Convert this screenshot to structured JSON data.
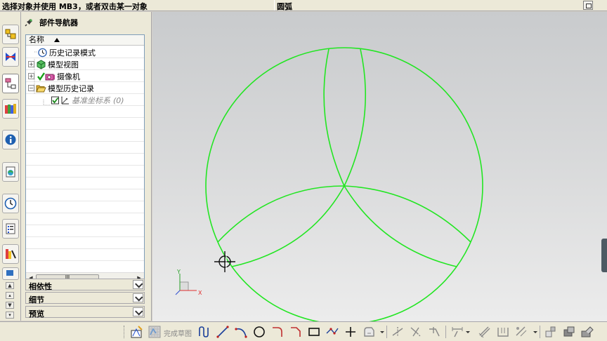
{
  "statusbar": {
    "prompt": "选择对象并使用 MB3，或者双击某一对象",
    "mode": "圆弧"
  },
  "navigator": {
    "title": "部件导航器",
    "column_name": "名称",
    "nodes": [
      {
        "label": "历史记录模式",
        "icon": "clock-icon",
        "expander": ""
      },
      {
        "label": "模型视图",
        "icon": "model-views-icon",
        "expander": "+"
      },
      {
        "label": "摄像机",
        "icon": "camera-icon",
        "expander": "+"
      },
      {
        "label": "模型历史记录",
        "icon": "folder-open-icon",
        "expander": "−"
      },
      {
        "label": "基准坐标系",
        "count": "(0)",
        "icon": "datum-csys-icon",
        "expander": ""
      }
    ],
    "scroll_thumb": "III",
    "sections": [
      {
        "label": "相依性"
      },
      {
        "label": "细节"
      },
      {
        "label": "预览"
      }
    ]
  },
  "toolbar": {
    "finish_sketch_label": "完成草图"
  },
  "graphics": {
    "curve_color": "#22e622",
    "axis_x": "X",
    "axis_y": "Y"
  }
}
